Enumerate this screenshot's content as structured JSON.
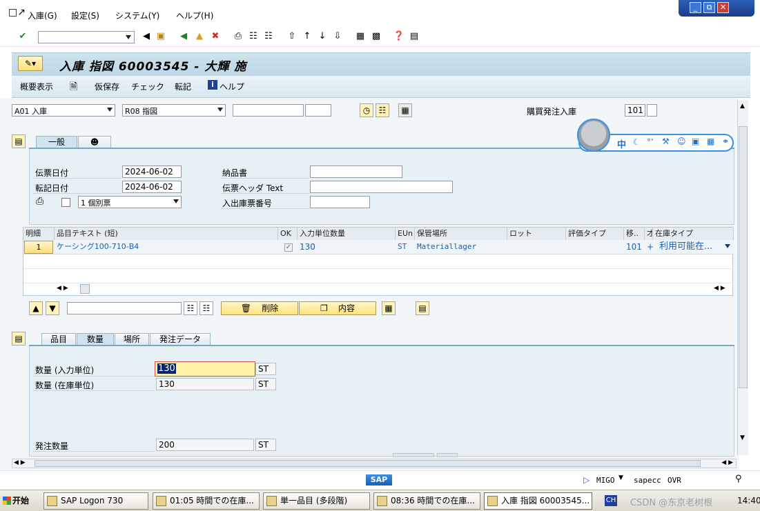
{
  "menubar": {
    "items": [
      "入庫(G)",
      "設定(S)",
      "システム(Y)",
      "ヘルプ(H)"
    ]
  },
  "title": "入庫 指図 60003545 - 大輝 施",
  "appbar": {
    "overview": "概要表示",
    "hold": "仮保存",
    "check": "チェック",
    "post": "転記",
    "help": "ヘルプ"
  },
  "header": {
    "action": "A01 入庫",
    "reference": "R08 指図",
    "movement_label": "購買発注入庫",
    "movement_type": "101"
  },
  "general_tabs": [
    "一般"
  ],
  "general": {
    "doc_date_label": "伝票日付",
    "doc_date": "2024-06-02",
    "posting_date_label": "転記日付",
    "posting_date": "2024-06-02",
    "slip_option": "1 個別票",
    "delivery_note_label": "納品書",
    "header_text_label": "伝票ヘッダ Text",
    "goods_slip_label": "入出庫票番号"
  },
  "grid": {
    "columns": [
      "明細",
      "品目テキスト (短)",
      "OK",
      "入力単位数量",
      "EUn",
      "保管場所",
      "ロット",
      "評価タイプ",
      "移..",
      "才",
      "在庫タイプ"
    ],
    "row": {
      "line": "1",
      "material_text": "ケーシング100-710-B4",
      "qty": "130",
      "unit": "ST",
      "storage_loc": "Materiallager",
      "movement": "101",
      "sign": "+",
      "stock_type": "利用可能在..."
    }
  },
  "item_actions": {
    "delete": "削除",
    "content": "内容"
  },
  "detail_tabs": [
    "品目",
    "数量",
    "場所",
    "発注データ"
  ],
  "quantity": {
    "entry_label": "数量 (入力単位)",
    "entry_value": "130",
    "entry_unit": "ST",
    "stock_label": "数量 (在庫単位)",
    "stock_value": "130",
    "stock_unit": "ST",
    "po_label": "発注数量",
    "po_value": "200",
    "po_unit": "ST"
  },
  "ime": {
    "lang": "中"
  },
  "status": {
    "logo": "SAP",
    "tcode": "MIGO",
    "server": "sapecc",
    "mode": "OVR"
  },
  "taskbar": {
    "start": "开始",
    "tasks": [
      "SAP Logon 730",
      "01:05 時間での在庫...",
      "単一品目 (多段階)",
      "08:36 時間での在庫...",
      "入庫 指図 60003545..."
    ],
    "lang": "CH",
    "clock": "14:40",
    "watermark": "CSDN @东京老树根"
  }
}
